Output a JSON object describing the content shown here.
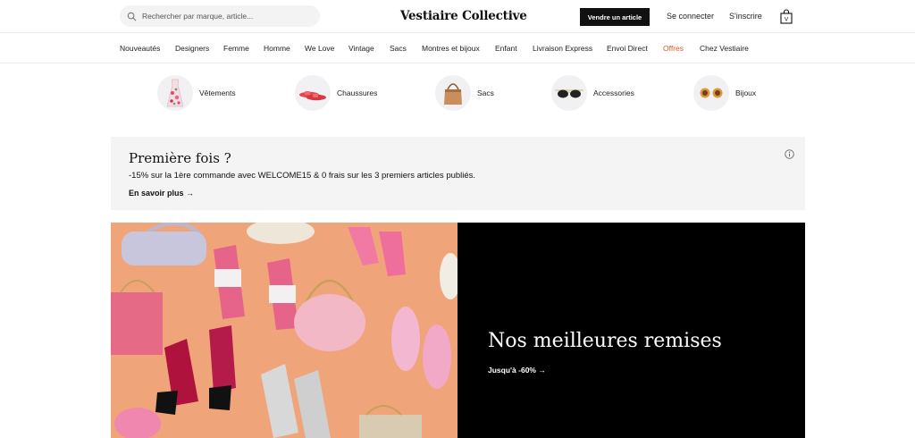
{
  "header": {
    "search_placeholder": "Rechercher par marque, article...",
    "logo": "Vestiaire Collective",
    "sell_button": "Vendre un article",
    "login": "Se connecter",
    "signup": "S'inscrire",
    "bag_badge": "V"
  },
  "nav": {
    "items": [
      {
        "label": "Nouveautés"
      },
      {
        "label": "Designers"
      },
      {
        "label": "Femme"
      },
      {
        "label": "Homme"
      },
      {
        "label": "We Love"
      },
      {
        "label": "Vintage"
      },
      {
        "label": "Sacs"
      },
      {
        "label": "Montres et bijoux"
      },
      {
        "label": "Enfant"
      },
      {
        "label": "Livraison Express"
      },
      {
        "label": "Envoi Direct"
      },
      {
        "label": "Offres"
      },
      {
        "label": "Chez Vestiaire"
      }
    ],
    "highlight_color": "#e0592a"
  },
  "categories": [
    {
      "label": "Vêtements",
      "icon": "dress-thumbnail"
    },
    {
      "label": "Chaussures",
      "icon": "shoes-thumbnail"
    },
    {
      "label": "Sacs",
      "icon": "bag-thumbnail"
    },
    {
      "label": "Accessories",
      "icon": "sunglasses-thumbnail"
    },
    {
      "label": "Bijoux",
      "icon": "earrings-thumbnail"
    }
  ],
  "promo": {
    "title": "Première fois ?",
    "text": "-15% sur la 1ère commande avec WELCOME15 & 0 frais sur les 3 premiers articles publiés.",
    "link": "En savoir plus →",
    "info_icon": "info-icon"
  },
  "hero": {
    "title": "Nos meilleures remises",
    "link": "Jusqu'à -60%  →",
    "background_color": "#f0a47a"
  }
}
